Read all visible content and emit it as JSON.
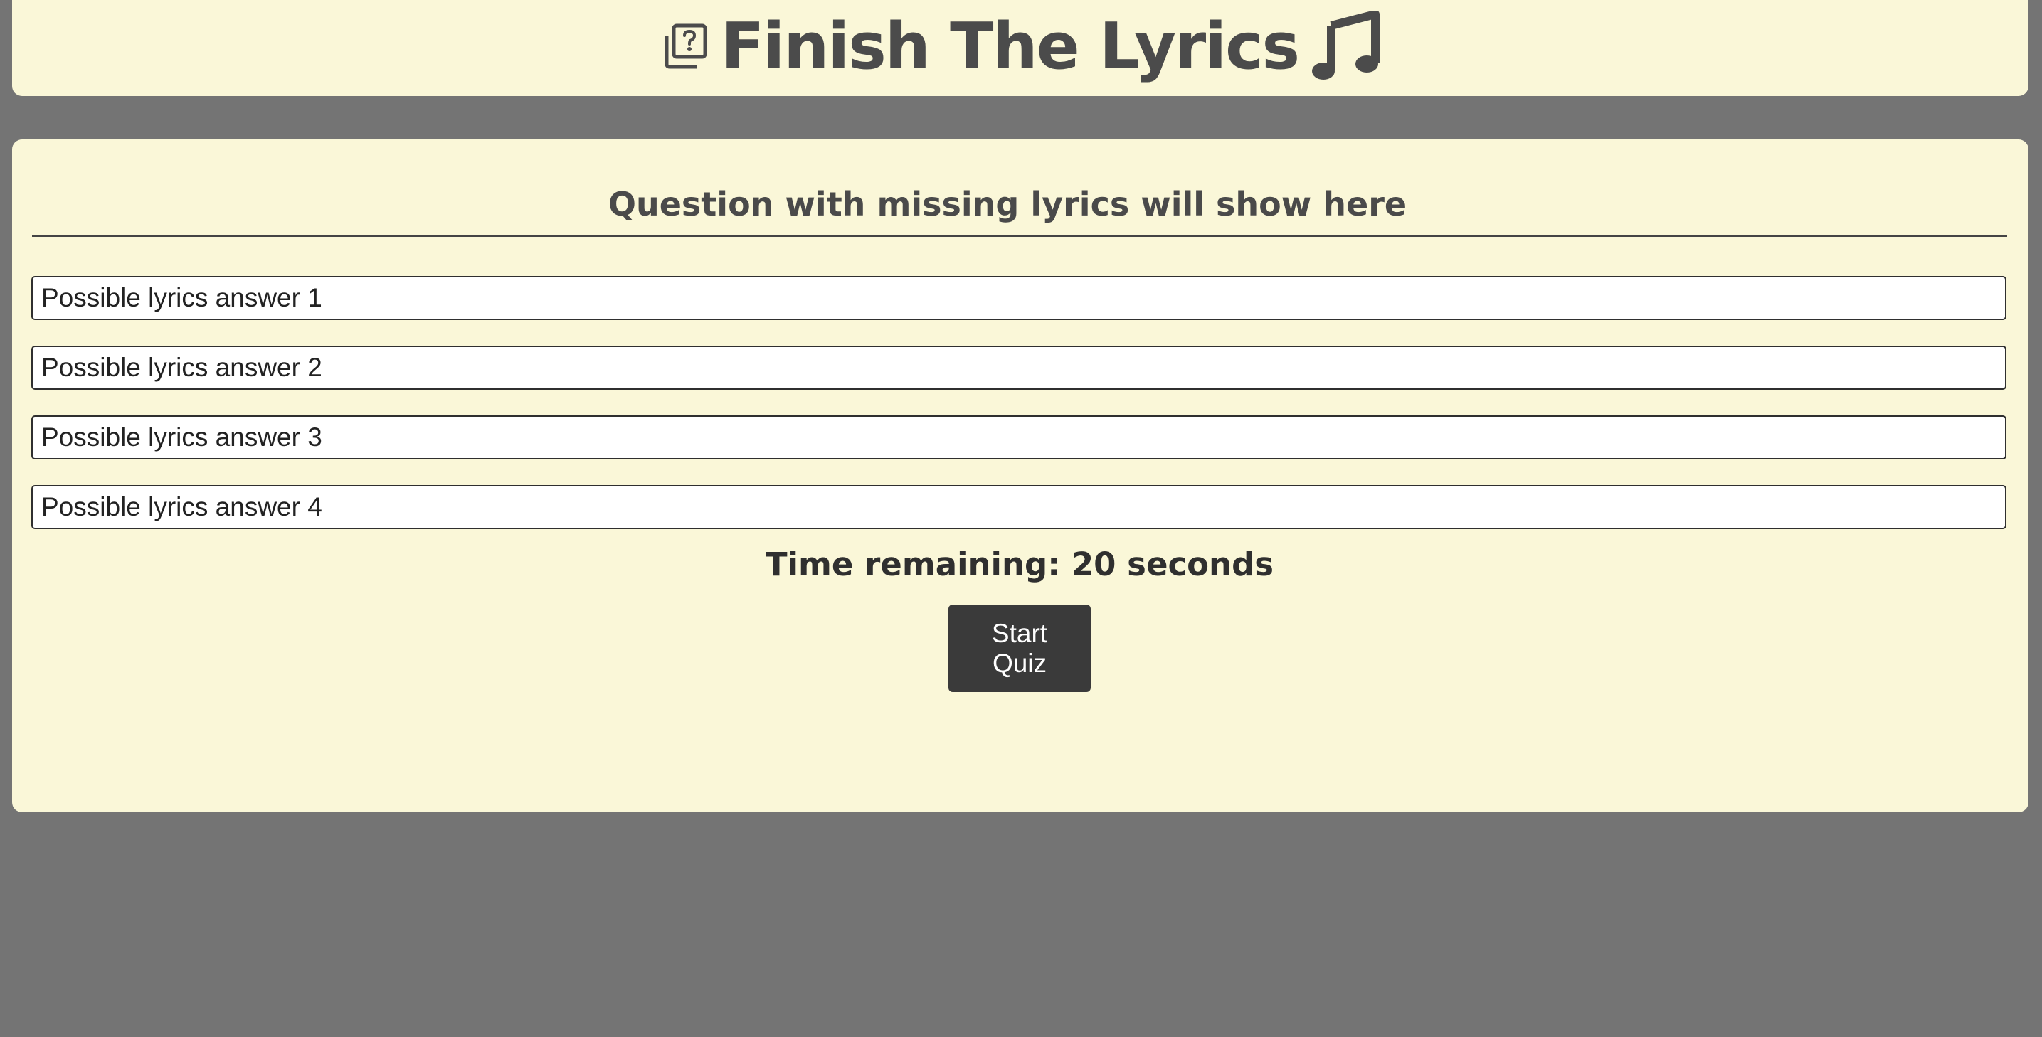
{
  "header": {
    "title": "Finish The Lyrics",
    "left_icon": "quiz-icon",
    "right_icon": "music-note-icon"
  },
  "question": {
    "text": "Question with missing lyrics will show here"
  },
  "answers": [
    {
      "label": "Possible lyrics answer 1"
    },
    {
      "label": "Possible lyrics answer 2"
    },
    {
      "label": "Possible lyrics answer 3"
    },
    {
      "label": "Possible lyrics answer 4"
    }
  ],
  "timer": {
    "text": "Time remaining: 20 seconds"
  },
  "start_button": {
    "label": "Start Quiz"
  },
  "colors": {
    "page_background": "#747474",
    "panel_background": "#faf7d8",
    "title_text": "#4b4b4b",
    "button_background": "#3a3a3a",
    "button_text": "#ffffff"
  }
}
